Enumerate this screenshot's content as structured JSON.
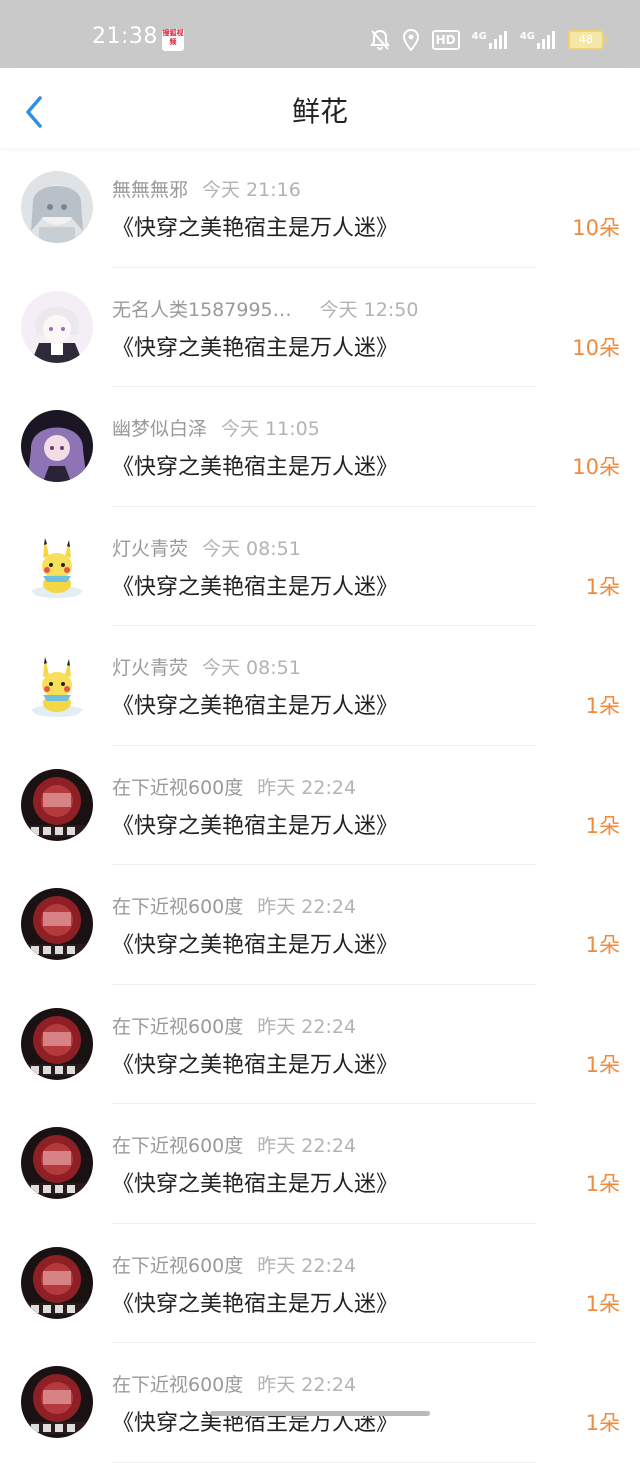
{
  "status_bar": {
    "time": "21:38",
    "app_icon_text": "搜狐视频",
    "network_hd": "HD",
    "network_1": "4G",
    "network_2": "4G",
    "battery": "48"
  },
  "nav": {
    "title": "鲜花",
    "back_icon": "chevron-left-icon"
  },
  "items": [
    {
      "name": "無無無邪",
      "time": "今天 21:16",
      "book": "《快穿之美艳宿主是万人迷》",
      "count": "10朵",
      "avatar": "avatar-anime-girl-gray"
    },
    {
      "name": "无名人类1587995…",
      "time": "今天 12:50",
      "book": "《快穿之美艳宿主是万人迷》",
      "count": "10朵",
      "avatar": "avatar-anime-boy-white"
    },
    {
      "name": "幽梦似白泽",
      "time": "今天 11:05",
      "book": "《快穿之美艳宿主是万人迷》",
      "count": "10朵",
      "avatar": "avatar-anime-purple-hair"
    },
    {
      "name": "灯火青荧",
      "time": "今天 08:51",
      "book": "《快穿之美艳宿主是万人迷》",
      "count": "1朵",
      "avatar": "avatar-pikachu"
    },
    {
      "name": "灯火青荧",
      "time": "今天 08:51",
      "book": "《快穿之美艳宿主是万人迷》",
      "count": "1朵",
      "avatar": "avatar-pikachu"
    },
    {
      "name": "在下近视600度",
      "time": "昨天 22:24",
      "book": "《快穿之美艳宿主是万人迷》",
      "count": "1朵",
      "avatar": "avatar-red-jelly"
    },
    {
      "name": "在下近视600度",
      "time": "昨天 22:24",
      "book": "《快穿之美艳宿主是万人迷》",
      "count": "1朵",
      "avatar": "avatar-red-jelly"
    },
    {
      "name": "在下近视600度",
      "time": "昨天 22:24",
      "book": "《快穿之美艳宿主是万人迷》",
      "count": "1朵",
      "avatar": "avatar-red-jelly"
    },
    {
      "name": "在下近视600度",
      "time": "昨天 22:24",
      "book": "《快穿之美艳宿主是万人迷》",
      "count": "1朵",
      "avatar": "avatar-red-jelly"
    },
    {
      "name": "在下近视600度",
      "time": "昨天 22:24",
      "book": "《快穿之美艳宿主是万人迷》",
      "count": "1朵",
      "avatar": "avatar-red-jelly"
    },
    {
      "name": "在下近视600度",
      "time": "昨天 22:24",
      "book": "《快穿之美艳宿主是万人迷》",
      "count": "1朵",
      "avatar": "avatar-red-jelly"
    }
  ],
  "colors": {
    "accent": "#2f8fe0",
    "count": "#f08a3c",
    "title": "#222222",
    "meta": "#9a9a9a",
    "status_bar": "#c9c9c9"
  }
}
